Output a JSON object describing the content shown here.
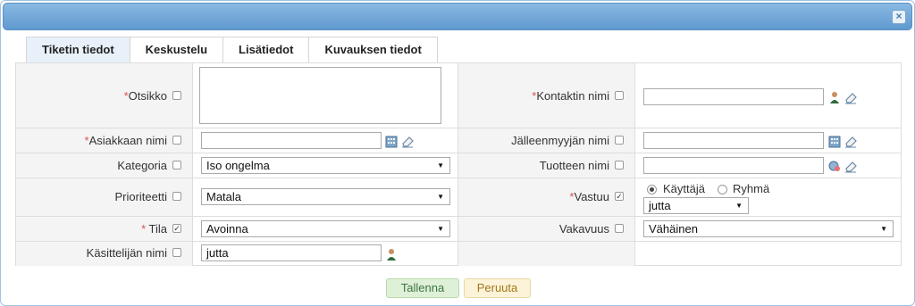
{
  "tabs": [
    {
      "label": "Tiketin tiedot"
    },
    {
      "label": "Keskustelu"
    },
    {
      "label": "Lisätiedot"
    },
    {
      "label": "Kuvauksen tiedot"
    }
  ],
  "fields": {
    "otsikko": {
      "label": "Otsikko",
      "required": "*",
      "value": ""
    },
    "asiakkaan_nimi": {
      "label": "Asiakkaan nimi",
      "required": "*",
      "value": ""
    },
    "kategoria": {
      "label": "Kategoria",
      "value": "Iso ongelma"
    },
    "prioriteetti": {
      "label": "Prioriteetti",
      "value": "Matala"
    },
    "tila": {
      "label": " Tila",
      "required": "*",
      "value": "Avoinna"
    },
    "kasittelijan_nimi": {
      "label": "Käsittelijän nimi",
      "value": "jutta"
    },
    "kontaktin_nimi": {
      "label": "Kontaktin nimi",
      "required": "*",
      "value": ""
    },
    "jalleenmyyjan_nimi": {
      "label": "Jälleenmyyjän nimi",
      "value": ""
    },
    "tuotteen_nimi": {
      "label": "Tuotteen nimi",
      "value": ""
    },
    "vastuu": {
      "label": "Vastuu",
      "required": "*",
      "radio_user": "Käyttäjä",
      "radio_group": "Ryhmä",
      "value": "jutta"
    },
    "vakavuus": {
      "label": "Vakavuus",
      "value": "Vähäinen"
    }
  },
  "buttons": {
    "save": "Tallenna",
    "cancel": "Peruuta"
  },
  "icons": {
    "close": "×",
    "checkmark": "✓",
    "dropdown": "▼"
  },
  "colors": {
    "title_bar": "#6fa6da",
    "required": "#d9534f",
    "save": "#dff0d8",
    "cancel": "#fcf3d8"
  }
}
